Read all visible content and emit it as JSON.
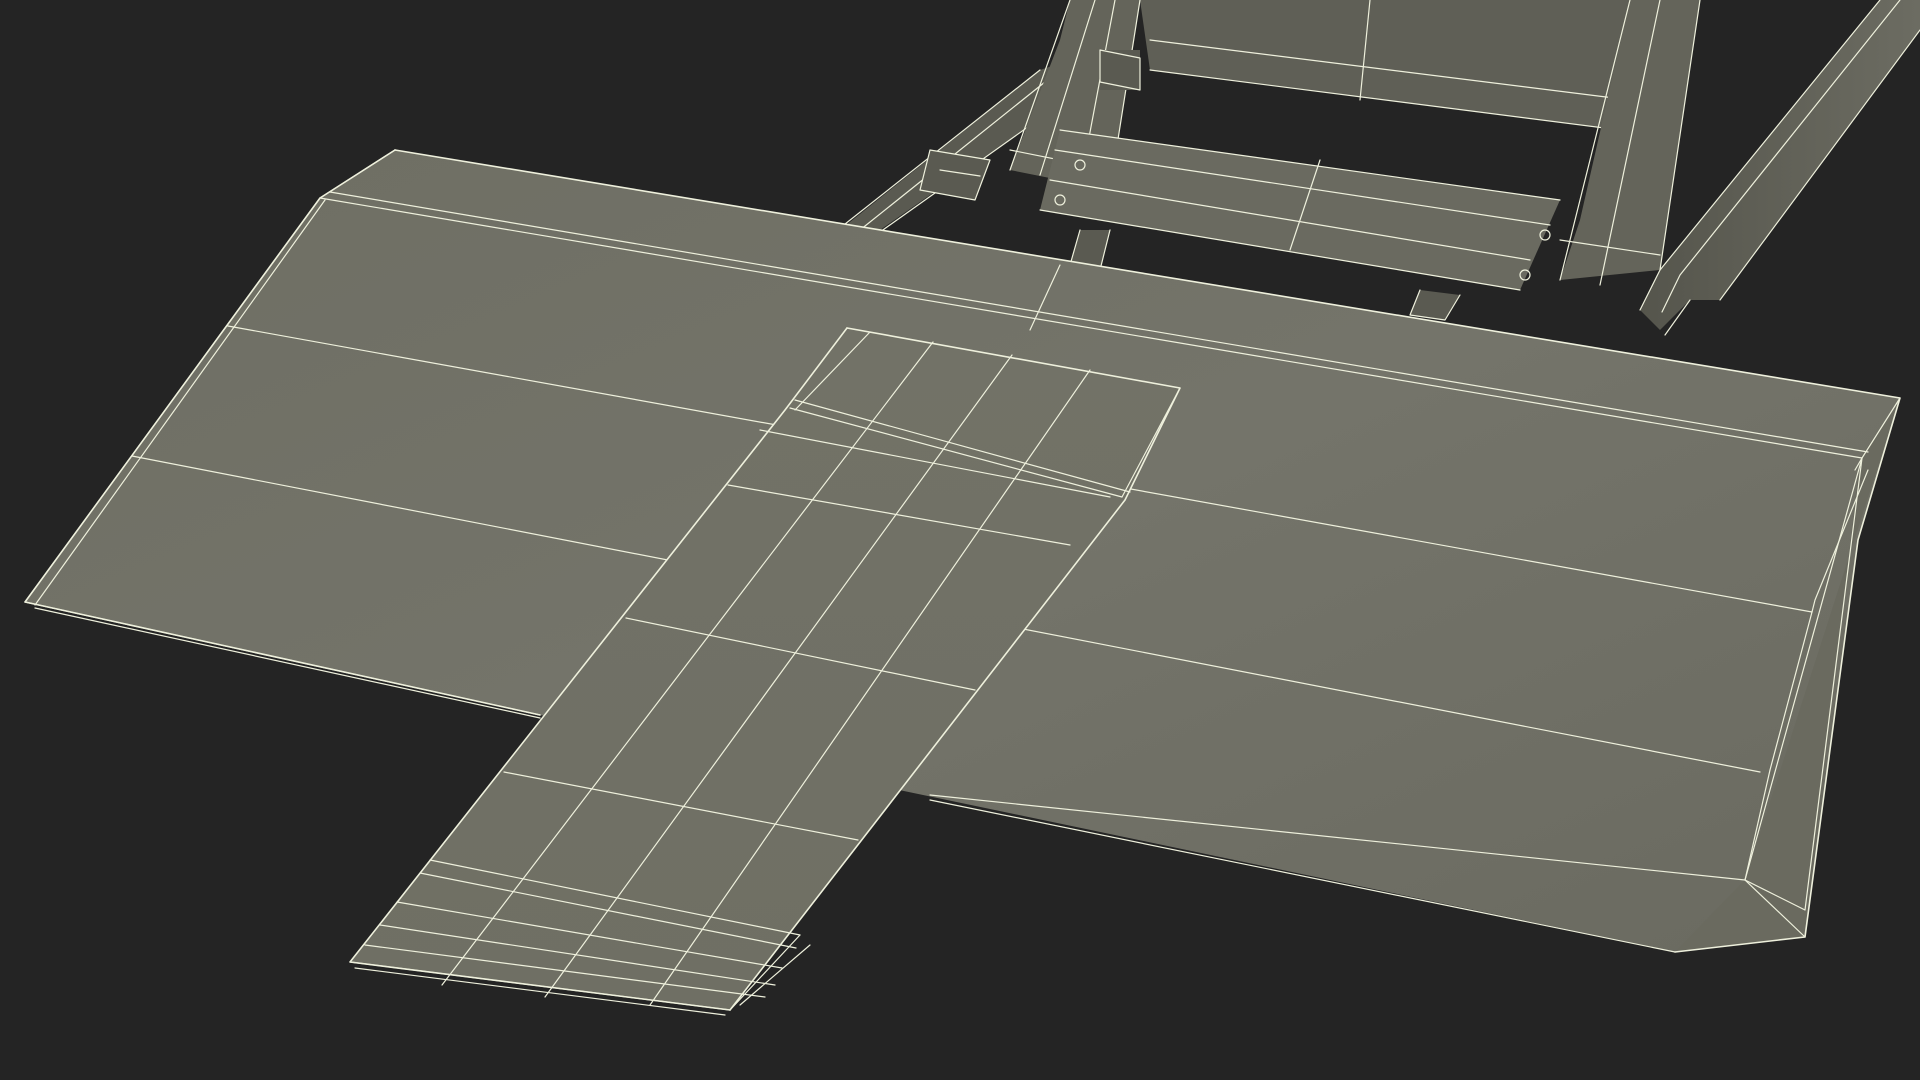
{
  "scene": {
    "background_color": "#242424",
    "surface_color": "#737368",
    "surface_light_color": "#7a7a6e",
    "surface_dark_color": "#5f5f55",
    "frame_color": "#65655b",
    "wire_color": "#eef0dc",
    "objects": [
      "large-platform-plate",
      "ramp-plate",
      "lift-frame-assembly"
    ]
  }
}
